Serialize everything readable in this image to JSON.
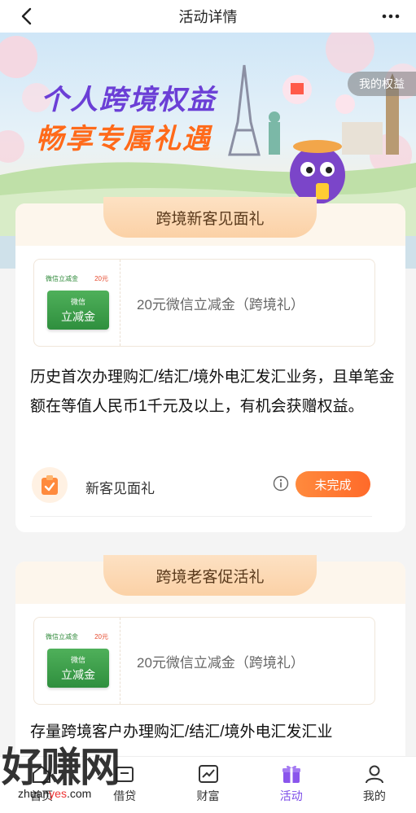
{
  "header": {
    "title": "活动详情"
  },
  "banner": {
    "title_line1": "个人跨境权益",
    "title_line2": "畅享专属礼遇",
    "my_rights_button": "我的权益"
  },
  "cards": [
    {
      "tab_title": "跨境新客见面礼",
      "coupon": {
        "mini_label": "微信立减金",
        "mini_price": "20元",
        "green_small": "微信",
        "green_big": "立减金",
        "title": "20元微信立减金（跨境礼）"
      },
      "description": "历史首次办理购汇/结汇/境外电汇发汇业务，且单笔金额在等值人民币1千元及以上，有机会获赠权益。",
      "task": {
        "label": "新客见面礼",
        "status": "未完成"
      }
    },
    {
      "tab_title": "跨境老客促活礼",
      "coupon": {
        "mini_label": "微信立减金",
        "mini_price": "20元",
        "green_small": "微信",
        "green_big": "立减金",
        "title": "20元微信立减金（跨境礼）"
      },
      "description": "存量跨境客户办理购汇/结汇/境外电汇发汇业"
    }
  ],
  "bottom_nav": [
    {
      "label": "首页",
      "icon": "home-icon"
    },
    {
      "label": "借贷",
      "icon": "loan-icon"
    },
    {
      "label": "财富",
      "icon": "trend-chart-icon"
    },
    {
      "label": "活动",
      "icon": "gift-icon",
      "active": true
    },
    {
      "label": "我的",
      "icon": "user-icon"
    }
  ],
  "watermark": {
    "cn": "好赚网",
    "url_prefix": "zhuan",
    "url_highlight": "yes",
    "url_suffix": ".com"
  },
  "colors": {
    "accent_purple": "#7c4de8",
    "accent_orange": "#ff6a2a",
    "tab_peach": "#fbd1a6"
  }
}
